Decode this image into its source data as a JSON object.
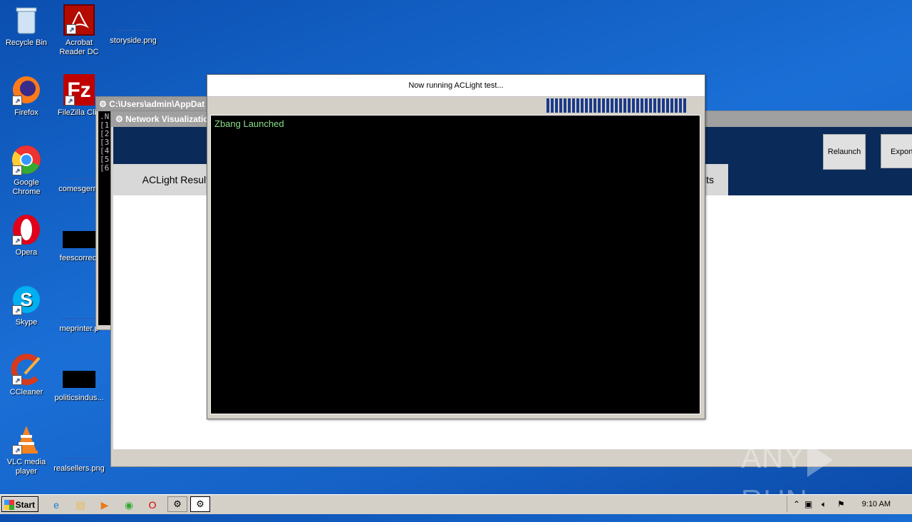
{
  "desktop": {
    "icons": [
      {
        "label": "Recycle Bin",
        "icon": "recycle-bin-icon"
      },
      {
        "label": "Acrobat Reader DC",
        "icon": "acrobat-icon"
      },
      {
        "label": "storyside.png",
        "icon": "image-file-icon"
      },
      {
        "label": "Firefox",
        "icon": "firefox-icon"
      },
      {
        "label": "FileZilla Clie",
        "icon": "filezilla-icon"
      },
      {
        "label": "Google Chrome",
        "icon": "chrome-icon"
      },
      {
        "label": "comesgerm",
        "icon": "file-icon"
      },
      {
        "label": "Opera",
        "icon": "opera-icon"
      },
      {
        "label": "feescorrect",
        "icon": "image-file-icon"
      },
      {
        "label": "Skype",
        "icon": "skype-icon"
      },
      {
        "label": "meprinter.p",
        "icon": "file-icon"
      },
      {
        "label": "CCleaner",
        "icon": "ccleaner-icon"
      },
      {
        "label": "politicsindus...",
        "icon": "image-file-icon"
      },
      {
        "label": "VLC media player",
        "icon": "vlc-icon"
      },
      {
        "label": "realsellers.png",
        "icon": "image-file-icon"
      }
    ]
  },
  "console": {
    "title": "C:\\Users\\admin\\AppDat",
    "lines": [
      ".N",
      "[1",
      "[2",
      "[3",
      "[4",
      "[5",
      "[6"
    ]
  },
  "netviz": {
    "title": "Network Visualizatio",
    "tab_left": "ACLight Result",
    "tab_right": "lts",
    "relaunch": "Relaunch",
    "export": "Export"
  },
  "dialog": {
    "header": "Now running ACLight test...",
    "progress_fraction": 0.95,
    "output": "Zbang Launched"
  },
  "watermark": {
    "left": "ANY",
    "right": "RUN"
  },
  "taskbar": {
    "start": "Start",
    "clock": "9:10 AM",
    "pinned": [
      "ie-icon",
      "explorer-icon",
      "media-player-icon",
      "chrome-icon",
      "opera-icon"
    ],
    "tasks": [
      "app-gear-icon",
      "app-gear-icon"
    ]
  },
  "colors": {
    "desktop_blue": "#1663c8",
    "banner_navy": "#0a2a5a",
    "progress_blue": "#1a3a8a",
    "terminal_green": "#88dd88"
  }
}
